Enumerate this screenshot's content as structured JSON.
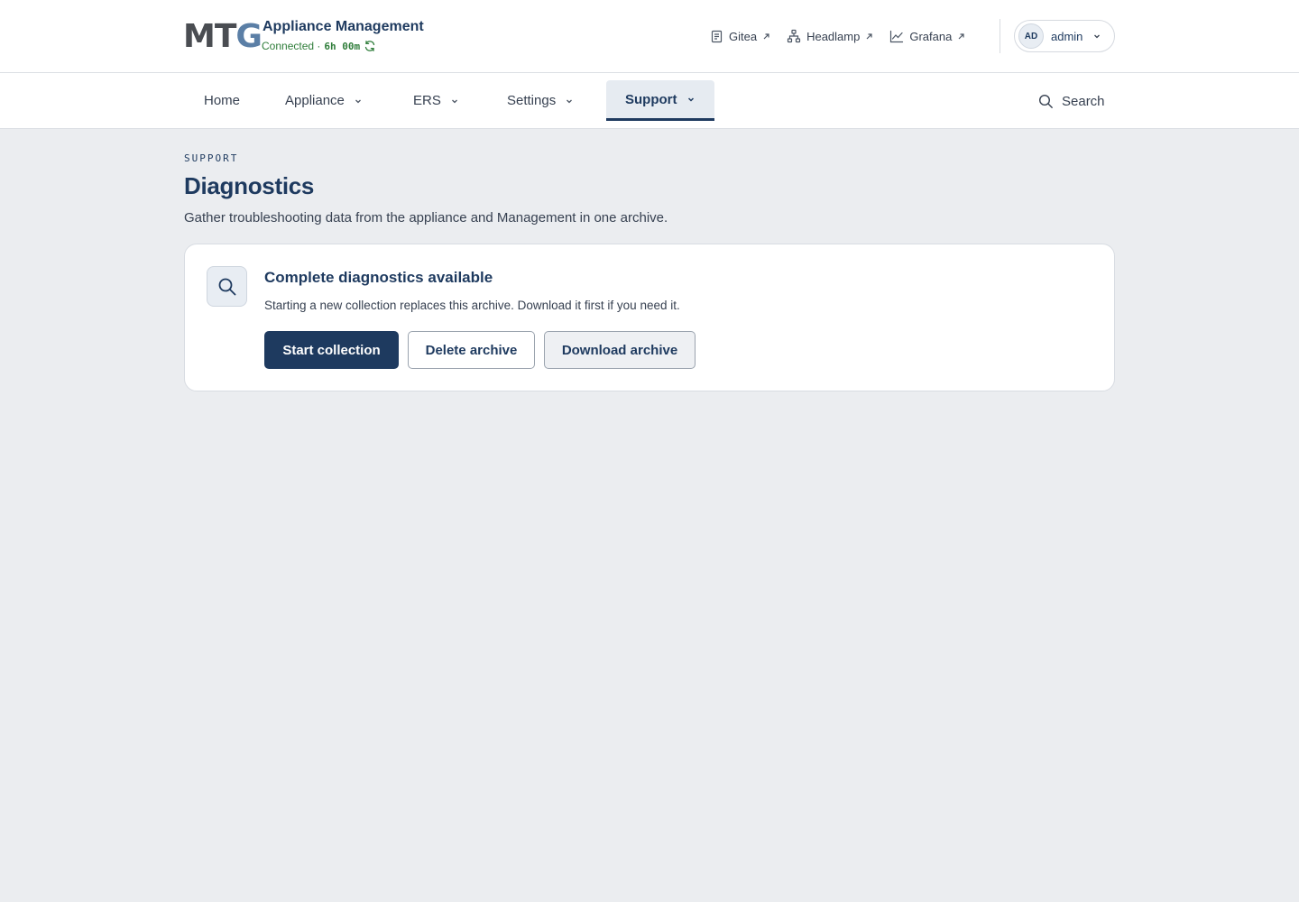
{
  "header": {
    "logo_left": "MT",
    "logo_right": "G",
    "app_title": "Appliance Management",
    "status_text": "Connected ·",
    "uptime": "6h 00m",
    "links": [
      {
        "label": "Gitea",
        "icon": "document-icon"
      },
      {
        "label": "Headlamp",
        "icon": "network-icon"
      },
      {
        "label": "Grafana",
        "icon": "chart-icon"
      }
    ],
    "user": {
      "initials": "AD",
      "name": "admin"
    }
  },
  "nav": {
    "items": [
      {
        "label": "Home"
      },
      {
        "label": "Appliance"
      },
      {
        "label": "ERS"
      },
      {
        "label": "Settings"
      },
      {
        "label": "Support",
        "active": true
      }
    ],
    "search_label": "Search"
  },
  "page": {
    "eyebrow": "SUPPORT",
    "title": "Diagnostics",
    "subtitle": "Gather troubleshooting data from the appliance and Management in one archive."
  },
  "card": {
    "title": "Complete diagnostics available",
    "text": "Starting a new collection replaces this archive. Download it first if you need it.",
    "buttons": {
      "start": "Start collection",
      "delete": "Delete archive",
      "download": "Download archive"
    }
  },
  "colors": {
    "primary": "#1e3a5f",
    "status_green": "#2f7d3a",
    "background": "#ebedf0"
  }
}
